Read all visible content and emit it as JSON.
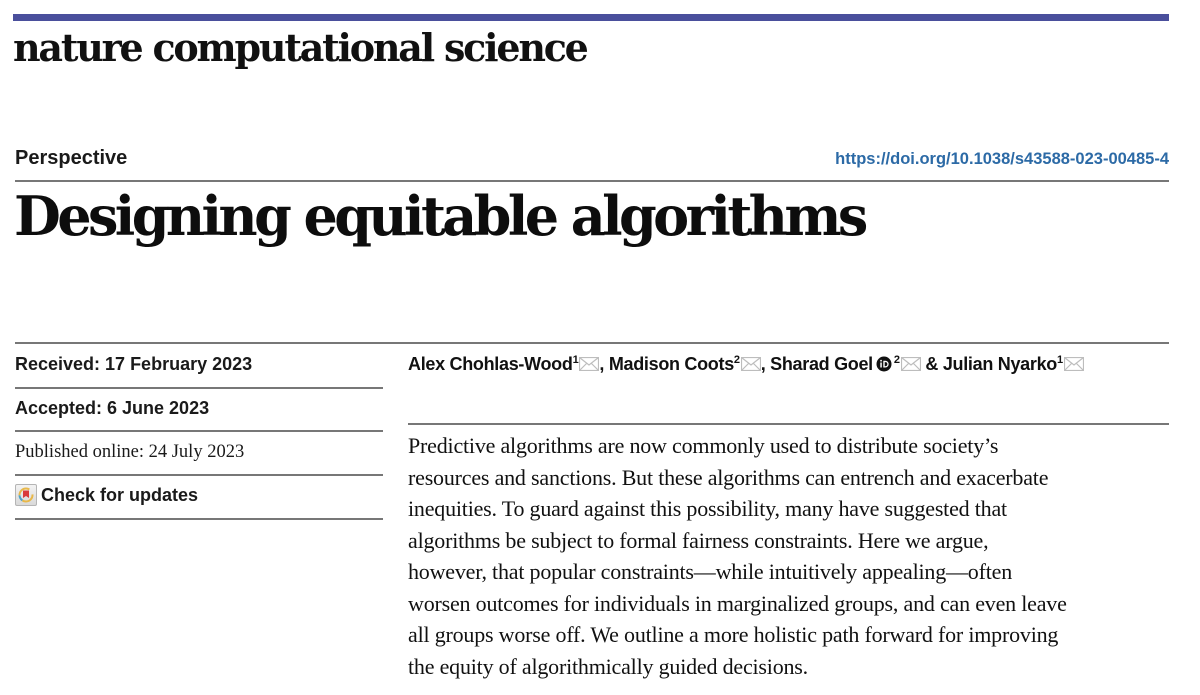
{
  "journal": {
    "name": "nature computational science",
    "brand_color": "#4a4f9c"
  },
  "article": {
    "type": "Perspective",
    "doi": "https://doi.org/10.1038/s43588-023-00485-4",
    "title": "Designing equitable algorithms"
  },
  "meta": {
    "received": "Received: 17 February 2023",
    "accepted": "Accepted: 6 June 2023",
    "published": "Published online: 24 July 2023",
    "check_updates": "Check for updates"
  },
  "authors": [
    {
      "name": "Alex Chohlas-Wood",
      "affiliation": "1",
      "sep": ", "
    },
    {
      "name": "Madison Coots",
      "affiliation": "2",
      "sep": ", "
    },
    {
      "name": "Sharad Goel",
      "affiliation": "2",
      "sep": " & "
    },
    {
      "name": "Julian Nyarko",
      "affiliation": "1",
      "sep": ""
    }
  ],
  "abstract": {
    "lines": [
      "Predictive algorithms are now commonly used to distribute society’s",
      "resources and sanctions. But these algorithms can entrench and exacerbate",
      "inequities. To guard against this possibility, many have suggested that",
      "algorithms be subject to formal fairness constraints. Here we argue,",
      "however, that popular constraints—while intuitively appealing—often",
      "worsen outcomes for individuals in marginalized groups, and can even leave",
      "all groups worse off. We outline a more holistic path forward for improving",
      "the equity of algorithmically guided decisions."
    ]
  },
  "colors": {
    "link": "#2c6aa6",
    "rule": "#777777",
    "text": "#111111"
  }
}
